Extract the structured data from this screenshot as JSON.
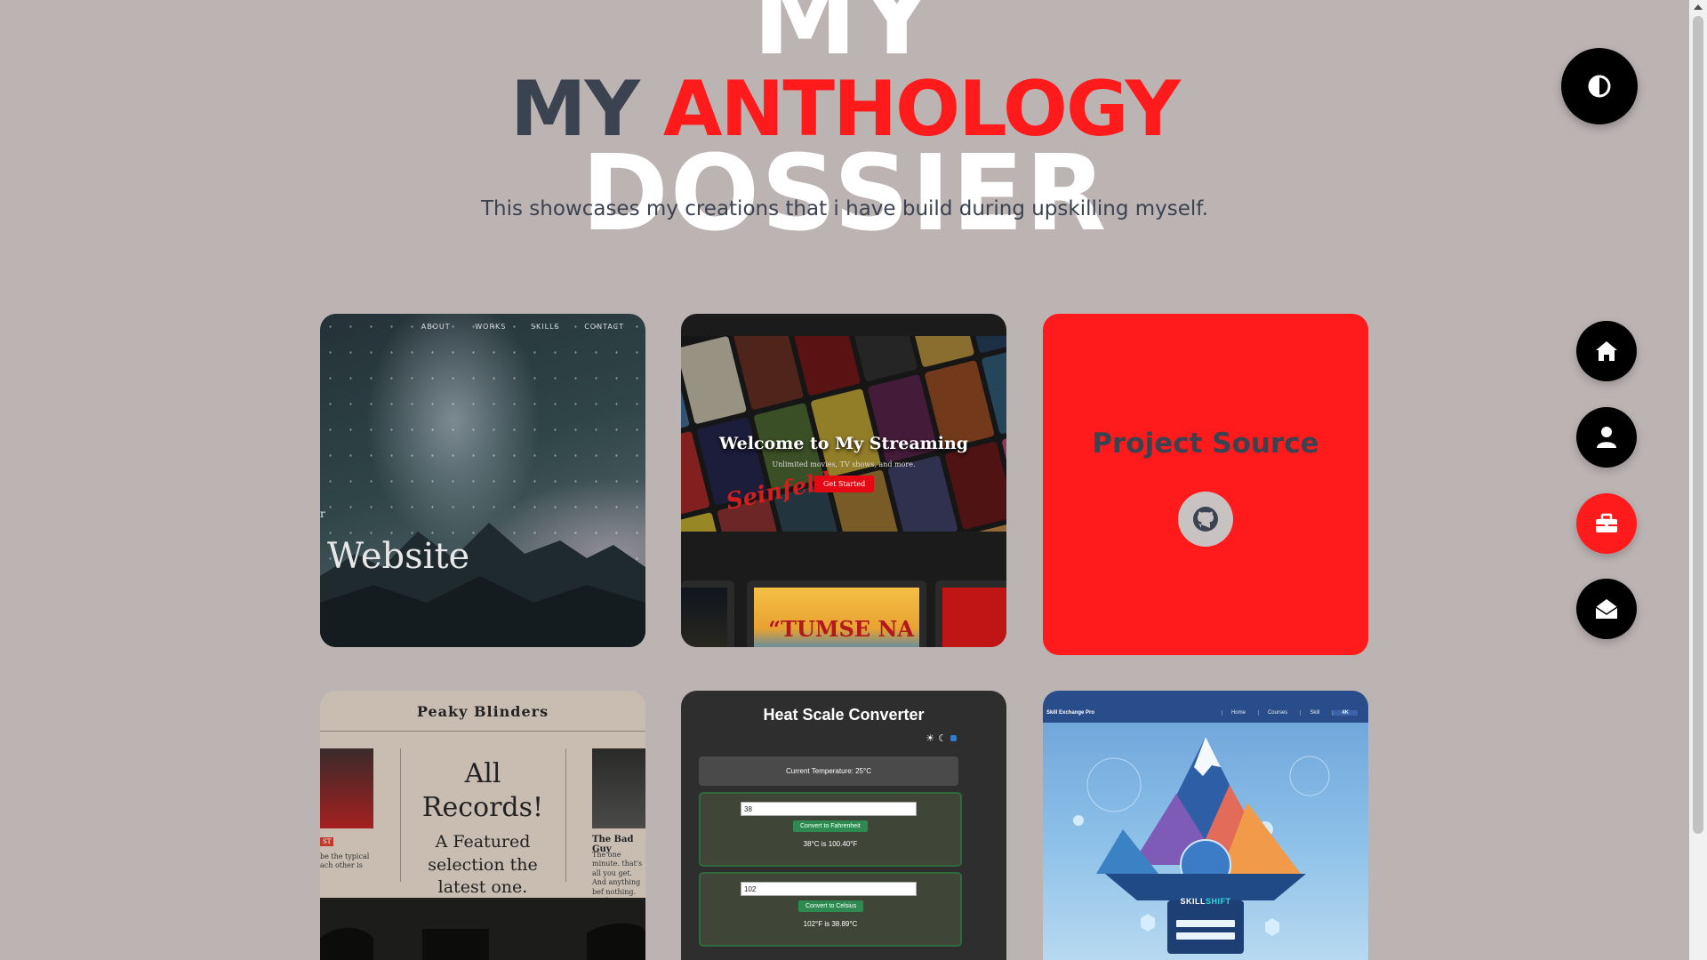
{
  "header": {
    "bg_top": "MY",
    "bg_bottom": "DOSSIER",
    "title_part1": "MY",
    "title_part2": "ANTHOLOGY",
    "subtitle": "This showcases my creations that i have build during upskilling myself."
  },
  "colors": {
    "accent": "#ff1b1b",
    "background": "#bcb3b3",
    "title_dark": "#3b4350"
  },
  "controls": {
    "theme_toggle_icon": "half-circle-icon"
  },
  "side_nav": [
    {
      "icon": "home-icon",
      "active": false
    },
    {
      "icon": "user-icon",
      "active": false
    },
    {
      "icon": "briefcase-icon",
      "active": true
    },
    {
      "icon": "envelope-open-icon",
      "active": false
    }
  ],
  "cards": {
    "website": {
      "nav": [
        "ABOUT",
        "WORKS",
        "SKILLS",
        "CONTACT"
      ],
      "fragment": "r",
      "heading": "Website"
    },
    "streaming": {
      "welcome": "Welcome to My Streaming",
      "subtitle": "Unlimited movies, TV shows, and more.",
      "cta": "Get Started",
      "poster_text": "Seinfeld",
      "tile_text": "“TUMSE NA"
    },
    "project_source": {
      "title": "Project Source",
      "icon": "github-icon"
    },
    "peaky": {
      "title": "Peaky Blinders",
      "big": "All Records!",
      "small": "A Featured selection the latest one.",
      "badguy": "The Bad Guy",
      "tag": "ST",
      "left_text": "be the typical ach other is",
      "right_text": "The one minute. that's all you get. And anything bef nothing. Nothing"
    },
    "heat": {
      "title": "Heat Scale Converter",
      "current": "Current Temperature: 25°C",
      "input1": "38",
      "button1": "Convert to Fahrenheit",
      "result1": "38°C is 100.40°F",
      "input2": "102",
      "button2": "Convert to Celsius",
      "result2": "102°F is 38.89°C"
    },
    "skill": {
      "brand": "Skill Exchange Pro",
      "links": [
        "Home",
        "Courses",
        "Skill",
        "4K"
      ],
      "logo_part1": "SKILL",
      "logo_part2": "SHIFT"
    }
  }
}
